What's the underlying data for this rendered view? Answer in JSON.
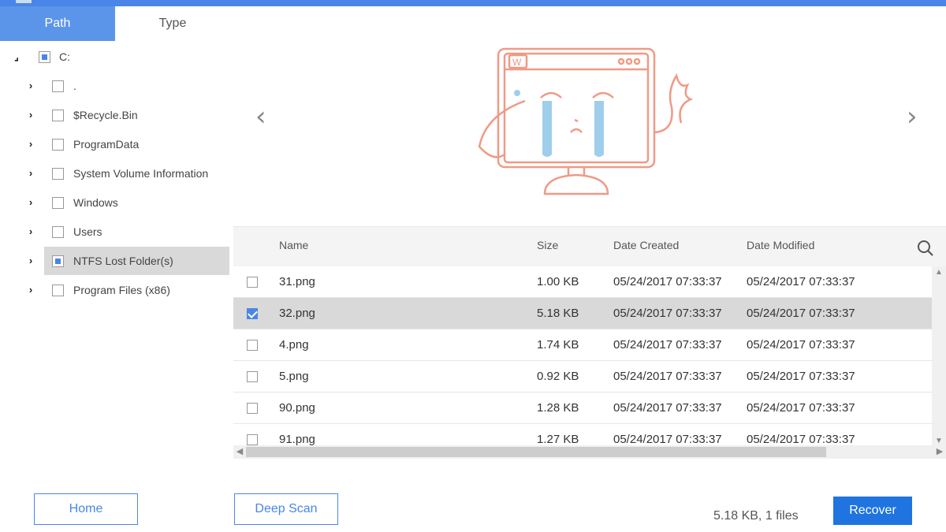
{
  "tabs": [
    {
      "label": "Path",
      "active": true
    },
    {
      "label": "Type",
      "active": false
    }
  ],
  "tree": {
    "root": {
      "label": "C:",
      "expanded": true,
      "checkbox": "partial"
    },
    "children": [
      {
        "label": ".",
        "checkbox": "unchecked",
        "selected": false
      },
      {
        "label": "$Recycle.Bin",
        "checkbox": "unchecked",
        "selected": false
      },
      {
        "label": "ProgramData",
        "checkbox": "unchecked",
        "selected": false
      },
      {
        "label": "System Volume Information",
        "checkbox": "unchecked",
        "selected": false
      },
      {
        "label": "Windows",
        "checkbox": "unchecked",
        "selected": false
      },
      {
        "label": "Users",
        "checkbox": "unchecked",
        "selected": false
      },
      {
        "label": "NTFS Lost Folder(s)",
        "checkbox": "partial",
        "selected": true
      },
      {
        "label": "Program Files (x86)",
        "checkbox": "unchecked",
        "selected": false
      }
    ]
  },
  "preview": {
    "illustration": "crying-computer-illustration",
    "prev_icon": "chevron-left-icon",
    "next_icon": "chevron-right-icon",
    "accent_color": "#ef9a86",
    "tear_color": "#8ec6e8"
  },
  "table": {
    "columns": {
      "name": "Name",
      "size": "Size",
      "created": "Date Created",
      "modified": "Date Modified"
    },
    "search_icon": "search-icon",
    "rows": [
      {
        "name": "31.png",
        "size": "1.00 KB",
        "created": "05/24/2017 07:33:37",
        "modified": "05/24/2017 07:33:37",
        "checked": false
      },
      {
        "name": "32.png",
        "size": "5.18 KB",
        "created": "05/24/2017 07:33:37",
        "modified": "05/24/2017 07:33:37",
        "checked": true
      },
      {
        "name": "4.png",
        "size": "1.74 KB",
        "created": "05/24/2017 07:33:37",
        "modified": "05/24/2017 07:33:37",
        "checked": false
      },
      {
        "name": "5.png",
        "size": "0.92 KB",
        "created": "05/24/2017 07:33:37",
        "modified": "05/24/2017 07:33:37",
        "checked": false
      },
      {
        "name": "90.png",
        "size": "1.28 KB",
        "created": "05/24/2017 07:33:37",
        "modified": "05/24/2017 07:33:37",
        "checked": false
      },
      {
        "name": "91.png",
        "size": "1.27 KB",
        "created": "05/24/2017 07:33:37",
        "modified": "05/24/2017 07:33:37",
        "checked": false
      }
    ]
  },
  "footer": {
    "home_label": "Home",
    "deep_scan_label": "Deep Scan",
    "status_text": "5.18 KB, 1 files",
    "recover_label": "Recover"
  },
  "colors": {
    "accent": "#4a86e8",
    "tab_active": "#5b95ea",
    "recover_button": "#1f74e0",
    "selection": "#d9d9d9"
  }
}
